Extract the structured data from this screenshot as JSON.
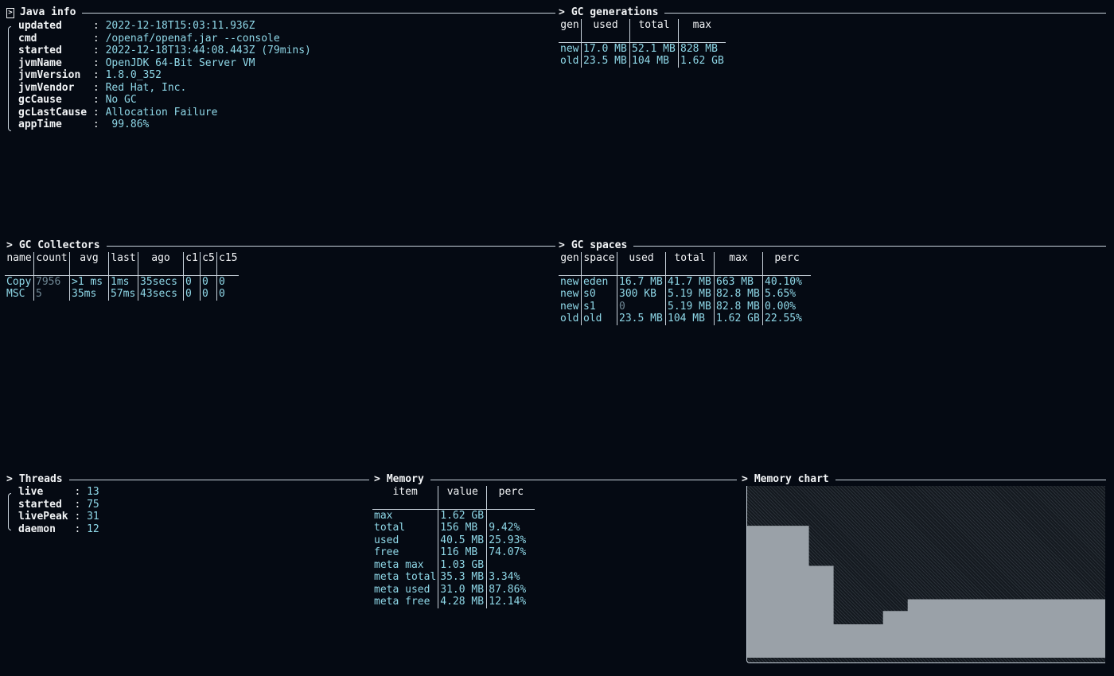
{
  "java_info": {
    "title": "Java info",
    "rows": [
      {
        "key": "updated",
        "value": "2022-12-18T15:03:11.936Z"
      },
      {
        "key": "cmd",
        "value": "/openaf/openaf.jar --console"
      },
      {
        "key": "started",
        "value": "2022-12-18T13:44:08.443Z (79mins)"
      },
      {
        "key": "jvmName",
        "value": "OpenJDK 64-Bit Server VM"
      },
      {
        "key": "jvmVersion",
        "value": "1.8.0_352"
      },
      {
        "key": "jvmVendor",
        "value": "Red Hat, Inc."
      },
      {
        "key": "gcCause",
        "value": "No GC"
      },
      {
        "key": "gcLastCause",
        "value": "Allocation Failure"
      },
      {
        "key": "appTime",
        "value": " 99.86%"
      }
    ]
  },
  "gc_generations": {
    "title": "GC generations",
    "headers": [
      "gen",
      "used",
      "total",
      "max"
    ],
    "rows": [
      [
        "new",
        "17.0 MB",
        "52.1 MB",
        "828 MB"
      ],
      [
        "old",
        "23.5 MB",
        "104 MB",
        "1.62 GB"
      ]
    ]
  },
  "gc_collectors": {
    "title": "GC Collectors",
    "headers": [
      "name",
      "count",
      "avg",
      "last",
      "ago",
      "c1",
      "c5",
      "c15"
    ],
    "rows": [
      [
        "Copy",
        "7956",
        ">1 ms",
        "1ms",
        "35secs",
        "0",
        "0",
        "0"
      ],
      [
        "MSC",
        "5",
        "35ms",
        "57ms",
        "43secs",
        "0",
        "0",
        "0"
      ]
    ]
  },
  "gc_spaces": {
    "title": "GC spaces",
    "headers": [
      "gen",
      "space",
      "used",
      "total",
      "max",
      "perc"
    ],
    "rows": [
      [
        "new",
        "eden",
        "16.7 MB",
        "41.7 MB",
        "663 MB",
        "40.10%"
      ],
      [
        "new",
        "s0",
        "300 KB",
        "5.19 MB",
        "82.8 MB",
        "5.65%"
      ],
      [
        "new",
        "s1",
        "0",
        "5.19 MB",
        "82.8 MB",
        "0.00%"
      ],
      [
        "old",
        "old",
        "23.5 MB",
        "104 MB",
        "1.62 GB",
        "22.55%"
      ]
    ]
  },
  "threads": {
    "title": "Threads",
    "rows": [
      {
        "key": "live",
        "value": "13"
      },
      {
        "key": "started",
        "value": "75"
      },
      {
        "key": "livePeak",
        "value": "31"
      },
      {
        "key": "daemon",
        "value": "12"
      }
    ]
  },
  "memory": {
    "title": "Memory",
    "headers": [
      "item",
      "value",
      "perc"
    ],
    "rows": [
      [
        "max",
        "1.62 GB",
        ""
      ],
      [
        "total",
        "156 MB",
        "9.42%"
      ],
      [
        "used",
        "40.5 MB",
        "25.93%"
      ],
      [
        "free",
        "116 MB",
        "74.07%"
      ],
      [
        "meta max",
        "1.03 GB",
        ""
      ],
      [
        "meta total",
        "35.3 MB",
        "3.34%"
      ],
      [
        "meta used",
        "31.0 MB",
        "87.86%"
      ],
      [
        "meta free",
        "4.28 MB",
        "12.14%"
      ]
    ]
  },
  "memory_chart": {
    "title": "Memory chart",
    "colors": {
      "fill": "#9aa1a8",
      "background": "#1b2127"
    },
    "chart_data": {
      "type": "area",
      "series": [
        {
          "values": [
            0.79,
            0.79,
            0.79,
            0.79,
            0.79,
            0.79,
            0.79,
            0.79,
            0.79,
            0.79,
            0.55,
            0.55,
            0.55,
            0.55,
            0.2,
            0.2,
            0.2,
            0.2,
            0.2,
            0.2,
            0.2,
            0.2,
            0.28,
            0.28,
            0.28,
            0.28,
            0.35,
            0.35,
            0.35,
            0.35,
            0.35,
            0.35,
            0.35,
            0.35,
            0.35,
            0.35,
            0.35,
            0.35,
            0.35,
            0.35,
            0.35,
            0.35,
            0.35,
            0.35,
            0.35,
            0.35,
            0.35,
            0.35,
            0.35,
            0.35,
            0.35,
            0.35,
            0.35,
            0.35,
            0.35,
            0.35,
            0.35,
            0.35
          ]
        }
      ],
      "ylim": [
        0,
        1
      ]
    }
  }
}
